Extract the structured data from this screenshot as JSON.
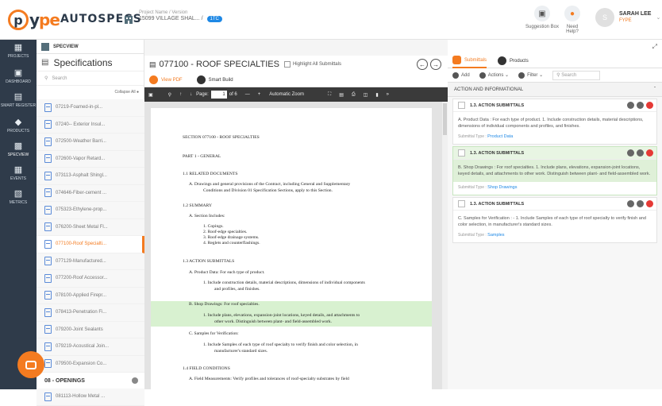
{
  "header": {
    "brand": "AUTOSPECS",
    "project_label": "Project Name / Version",
    "project_name": "15099 VILLAGE SHAL...",
    "project_tag": "1TC",
    "suggestion_box": "Suggestion Box",
    "need_help": "Need Help?",
    "user_name": "SARAH LEE",
    "user_sub": "FYPE",
    "avatar_initial": "S"
  },
  "leftnav": {
    "items": [
      {
        "label": "PROJECTS",
        "icon": "building-icon"
      },
      {
        "label": "DASHBOARD",
        "icon": "dashboard-icon"
      },
      {
        "label": "SMART REGISTER",
        "icon": "register-icon"
      },
      {
        "label": "PRODUCTS",
        "icon": "products-icon"
      },
      {
        "label": "SPECVIEW",
        "icon": "specview-icon"
      },
      {
        "label": "EVENTS",
        "icon": "calendar-icon"
      },
      {
        "label": "METRICS",
        "icon": "metrics-icon"
      }
    ]
  },
  "specpanel": {
    "header": "SPECVIEW",
    "title": "Specifications",
    "search_placeholder": "Search",
    "collapse_all": "Collapse All",
    "items": [
      "07219-Foamed-in-pl...",
      "07240-- Exterior Insul...",
      "072500-Weather Barri...",
      "072600-Vapor Retard...",
      "073113-Asphalt Shingl...",
      "074646-Fiber-cement ...",
      "075323-Ethylene-prop...",
      "076200-Sheet Metal Fl...",
      "077100-Roof Specialti...",
      "077129-Manufactured...",
      "077200-Roof Accessor...",
      "078100-Applied Firepr...",
      "078413-Penetration Fi...",
      "079200-Joint Sealants",
      "079219-Acoustical Join...",
      "079500-Expansion Co..."
    ],
    "active_index": 8,
    "division": "08 - OPENINGS",
    "division_item": "081113-Hollow Metal ..."
  },
  "doc": {
    "title": "077100 - ROOF SPECIALTIES",
    "highlight_label": "Highlight All Submittals",
    "tabs": [
      "View PDF",
      "Smart Build"
    ],
    "toolbar": {
      "page_label": "Page:",
      "page_value": "1",
      "page_of": "of 6",
      "zoom": "Automatic Zoom"
    },
    "lines": [
      "SECTION 077100 - ROOF SPECIALTIES",
      "PART 1 - GENERAL",
      "1.1       RELATED DOCUMENTS",
      "A.     Drawings and general provisions of the Contract, including General and Supplementary",
      "Conditions and Division 01 Specification Sections, apply to this Section.",
      "1.2       SUMMARY",
      "A.     Section Includes:",
      "1.     Copings.",
      "2.     Roof-edge specialties.",
      "3.     Roof-edge drainage systems.",
      "4.     Reglets and counterflashings.",
      "1.3       ACTION SUBMITTALS",
      "A.     Product Data: For each type of product.",
      "1.     Include construction details, material descriptions, dimensions of individual components",
      "and profiles, and finishes.",
      "B.     Shop Drawings: For roof specialties.",
      "1.     Include plans, elevations, expansion-joint locations, keyed details, and attachments to",
      "other work. Distinguish between plant- and field-assembled work.",
      "C.     Samples for Verification:",
      "1.     Include Samples of each type of roof specialty to verify finish and color selection, in",
      "manufacturer's standard sizes.",
      "1.4       FIELD CONDITIONS",
      "A.     Field Measurements: Verify profiles and tolerances of roof-specialty substrates by field"
    ]
  },
  "rpanel": {
    "tabs": [
      "Submittals",
      "Products"
    ],
    "tools": {
      "add": "Add",
      "actions": "Actions",
      "filter": "Filter",
      "search_placeholder": "Search"
    },
    "category": "ACTION AND INFORMATIONAL",
    "cards": [
      {
        "title": "1.3. ACTION SUBMITTALS",
        "body": "A. Product Data : For each type of product. 1. Include construction details, material descriptions, dimensions of individual components and profiles, and finishes.",
        "type_label": "Submittal Type :",
        "type": "Product Data"
      },
      {
        "title": "1.3. ACTION SUBMITTALS",
        "body": "B. Shop Drawings : For roof specialties. 1. Include plans, elevations, expansion-joint locations, keyed details, and attachments to other work. Distinguish between plant- and field-assembled work.",
        "type_label": "Submittal Type :",
        "type": "Shop Drawings"
      },
      {
        "title": "1.3. ACTION SUBMITTALS",
        "body": "C. Samples for Verification : - 1. Include Samples of each type of roof specialty to verify finish and color selection, in manufacturer's standard sizes.",
        "type_label": "Submittal Type :",
        "type": "Samples"
      }
    ]
  }
}
